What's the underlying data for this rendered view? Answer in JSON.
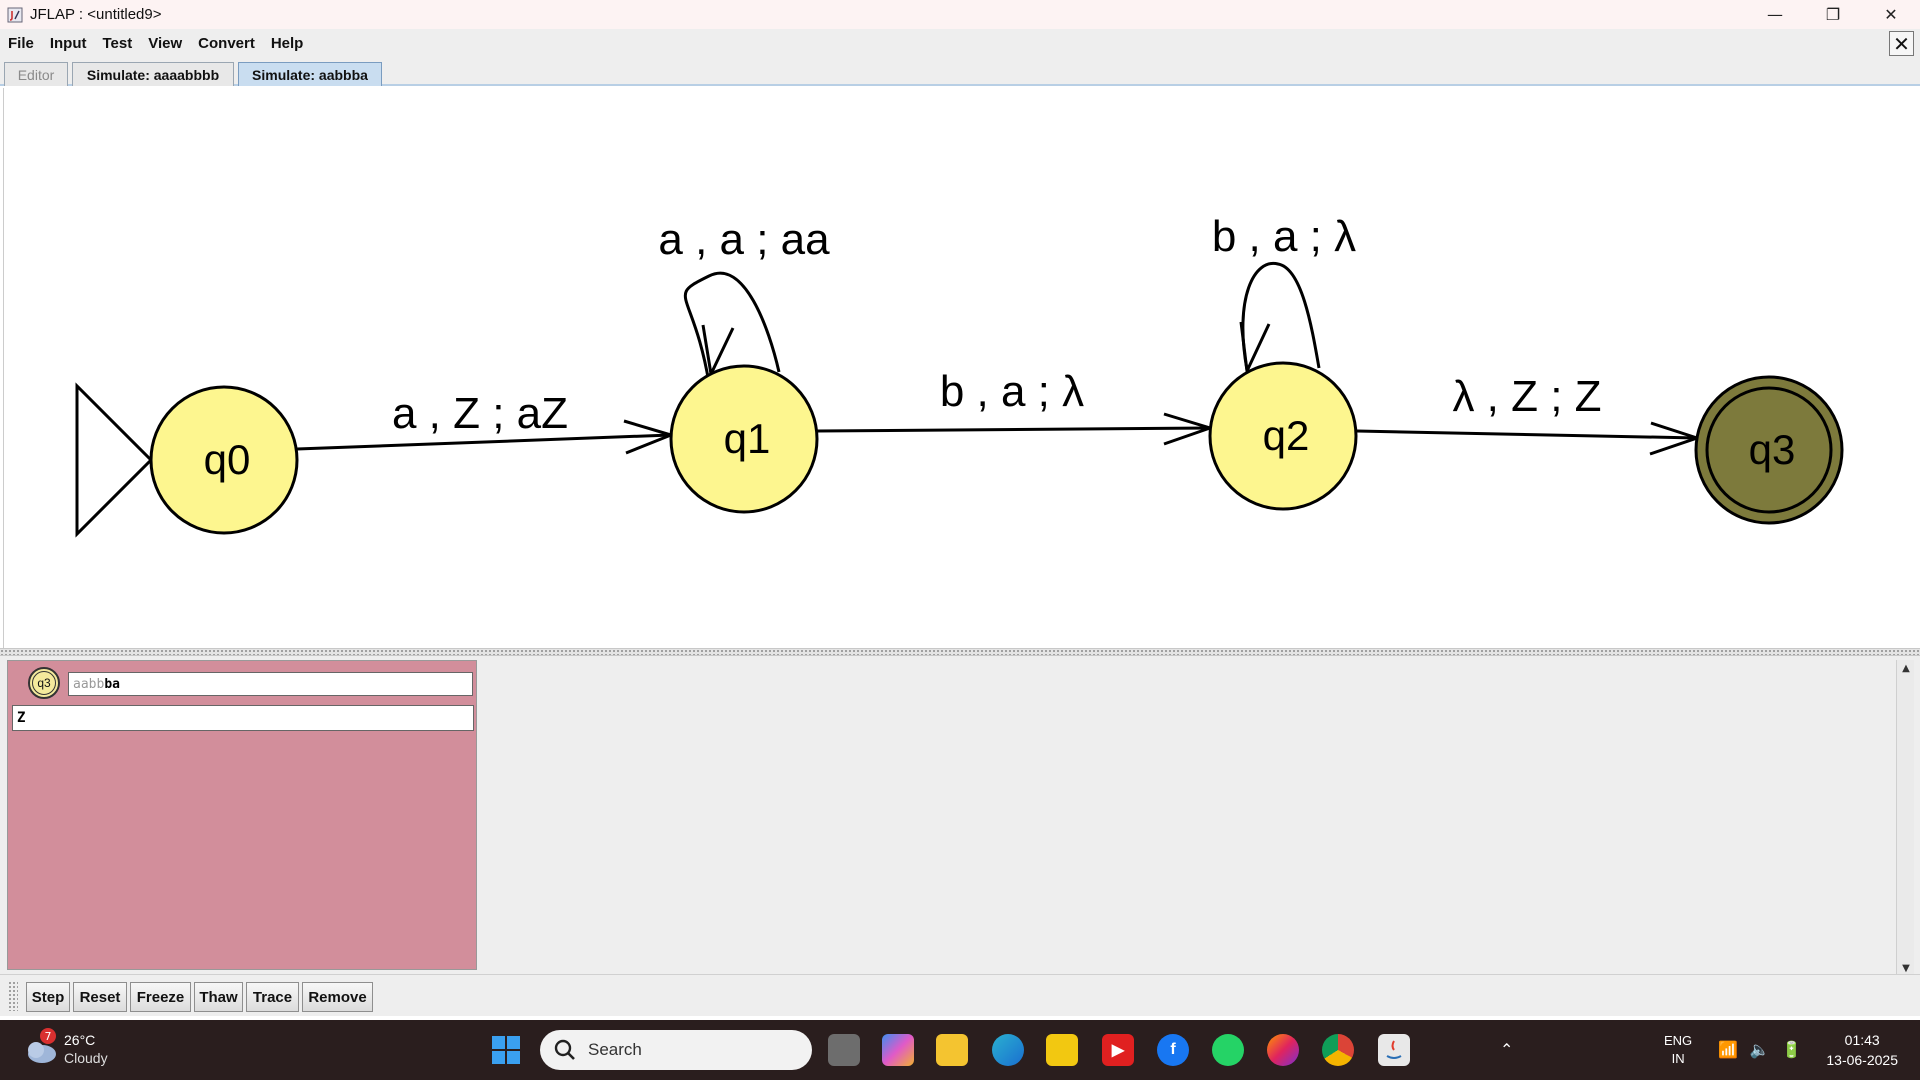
{
  "window": {
    "title": "JFLAP : <untitled9>",
    "minimize_glyph": "—",
    "restore_glyph": "❐",
    "close_glyph": "✕"
  },
  "menu": [
    "File",
    "Input",
    "Test",
    "View",
    "Convert",
    "Help"
  ],
  "close_doc_glyph": "✕",
  "tabs": [
    {
      "label": "Editor",
      "active": false
    },
    {
      "label": "Simulate: aaaabbbb",
      "active": false
    },
    {
      "label": "Simulate: aabbba",
      "active": true
    }
  ],
  "automaton": {
    "states": [
      {
        "name": "q0",
        "initial": true,
        "final": false
      },
      {
        "name": "q1",
        "initial": false,
        "final": false
      },
      {
        "name": "q2",
        "initial": false,
        "final": false
      },
      {
        "name": "q3",
        "initial": false,
        "final": true,
        "highlighted": true
      }
    ],
    "transitions": [
      {
        "from": "q0",
        "to": "q1",
        "label": "a , Z ; aZ"
      },
      {
        "from": "q1",
        "to": "q1",
        "label": "a , a ; aa"
      },
      {
        "from": "q1",
        "to": "q2",
        "label": "b , a ; λ"
      },
      {
        "from": "q2",
        "to": "q2",
        "label": "b , a ; λ"
      },
      {
        "from": "q2",
        "to": "q3",
        "label": "λ , Z ; Z"
      }
    ],
    "colors": {
      "state_fill": "#fdf68f",
      "final_fill": "#7d7a3c",
      "stroke": "#000000"
    }
  },
  "simulation": {
    "config": {
      "state": "q3",
      "input_consumed": "aabb",
      "input_remaining": "ba",
      "stack": "Z",
      "panel_color": "#d28e9b"
    },
    "buttons": [
      "Step",
      "Reset",
      "Freeze",
      "Thaw",
      "Trace",
      "Remove"
    ]
  },
  "taskbar": {
    "weather": {
      "temp": "26°C",
      "condition": "Cloudy",
      "badge": "7"
    },
    "search_placeholder": "Search",
    "apps": [
      "start-icon",
      "task-view-icon",
      "copilot-icon",
      "file-explorer-icon",
      "edge-icon",
      "power-bi-icon",
      "youtube-icon",
      "facebook-icon",
      "whatsapp-icon",
      "firefox-icon",
      "chrome-icon",
      "java-icon"
    ],
    "tray": {
      "lang": "ENG",
      "region": "IN"
    },
    "clock": {
      "time": "01:43",
      "date": "13-06-2025"
    }
  }
}
